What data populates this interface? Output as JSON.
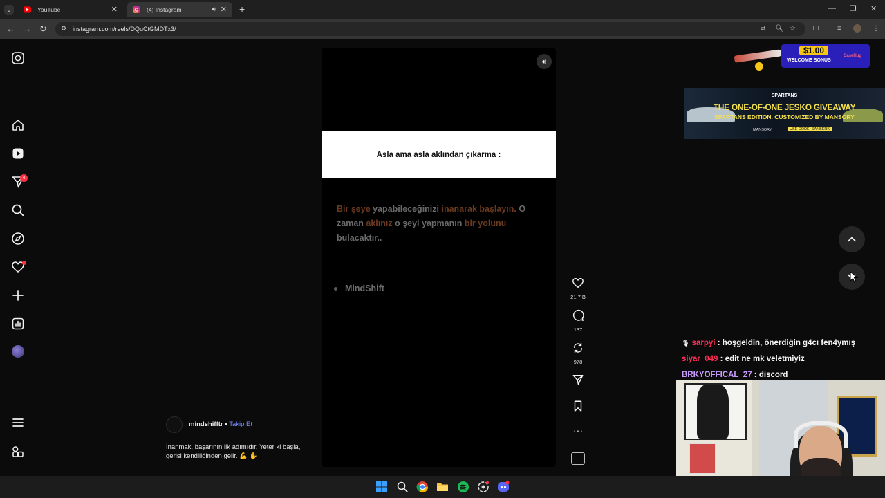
{
  "browser": {
    "tabs": [
      {
        "title": "YouTube",
        "active": false
      },
      {
        "title": "(4) Instagram",
        "active": true
      }
    ],
    "url": "instagram.com/reels/DQuCtGMDTx3/"
  },
  "sidebar": {
    "items": [
      "instagram-logo",
      "home",
      "reels",
      "messages",
      "search",
      "explore",
      "notifications",
      "create",
      "dashboard",
      "profile",
      "more",
      "also-from-meta"
    ],
    "messages_badge": "4"
  },
  "reel": {
    "banner_text": "Asla ama asla aklından çıkarma :",
    "quote_parts": [
      {
        "text": "Bir şeye",
        "hl": true
      },
      {
        "text": " yapabileceğinizi ",
        "hl": false
      },
      {
        "text": "inanarak başlayın.",
        "hl": true
      },
      {
        "text": " O zaman ",
        "hl": false
      },
      {
        "text": "aklınız",
        "hl": true
      },
      {
        "text": " o şeyi yapmanın ",
        "hl": false
      },
      {
        "text": "bir yolunu",
        "hl": true
      },
      {
        "text": " bulacaktır..",
        "hl": false
      }
    ],
    "bullet": "MindShift",
    "likes": "21,7 B",
    "comments": "137",
    "reposts": "978",
    "author": "mindshifftr",
    "follow_label": "Takip Et",
    "caption": "İnanmak, başarının ilk adımıdır. Yeter ki başla, gerisi kendiliğinden gelir. 💪 ✋"
  },
  "ads": {
    "top_price": "$1.00",
    "top_sub": "WELCOME BONUS",
    "top_brand": "CaseHug",
    "banner_brand": "SPARTANS",
    "banner_line1": "THE ONE-OF-ONE JESKO GIVEAWAY",
    "banner_line2": "SPARTANS EDITION. CUSTOMIZED BY MANSORY",
    "banner_small1": "MANSORY",
    "banner_small2": "USE CODE: SANBERK"
  },
  "chat": [
    {
      "user": "sarpyi",
      "color": "#ff2d55",
      "msg": "hoşgeldin, önerdiğin g4cı fen4ymış",
      "icon": true
    },
    {
      "user": "siyar_049",
      "color": "#ff2d55",
      "msg": "edit ne mk veletmiyiz",
      "icon": false
    },
    {
      "user": "BRKYOFFICAL_27",
      "color": "#c99bff",
      "msg": "discord",
      "icon": false
    }
  ],
  "colors": {
    "accent_link": "#7b8cff",
    "badge": "#ff3040",
    "highlight": "#6b3a1e"
  }
}
